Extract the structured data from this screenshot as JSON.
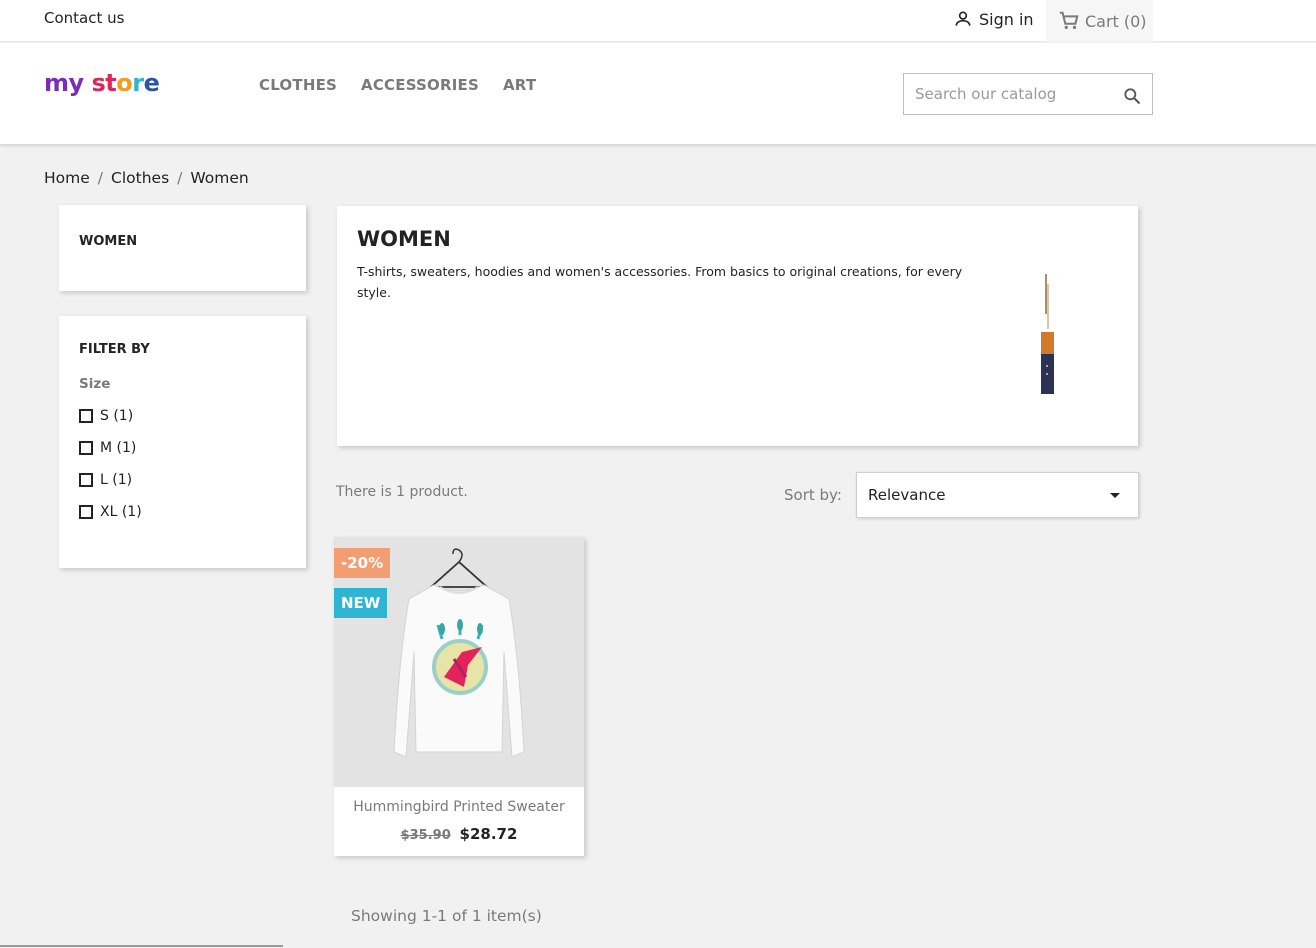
{
  "topbar": {
    "contact_label": "Contact us",
    "signin_label": "Sign in",
    "cart_label": "Cart",
    "cart_count": "(0)"
  },
  "header": {
    "logo_text": [
      "my",
      " ",
      "st",
      "o",
      "r",
      "e"
    ],
    "nav": [
      "CLOTHES",
      "ACCESSORIES",
      "ART"
    ],
    "search_placeholder": "Search our catalog"
  },
  "breadcrumb": [
    "Home",
    "Clothes",
    "Women"
  ],
  "sidebar": {
    "category_title": "WOMEN",
    "filter_title": "FILTER BY",
    "facet_label": "Size",
    "options": [
      {
        "label": "S (1)",
        "checked": false
      },
      {
        "label": "M (1)",
        "checked": false
      },
      {
        "label": "L (1)",
        "checked": false
      },
      {
        "label": "XL (1)",
        "checked": false
      }
    ]
  },
  "category": {
    "title": "WOMEN",
    "description": "T-shirts, sweaters, hoodies and women's accessories. From basics to original creations, for every style."
  },
  "listing": {
    "count_text": "There is 1 product.",
    "sort_label": "Sort by:",
    "sort_value": "Relevance",
    "showing_text": "Showing 1-1 of 1 item(s)"
  },
  "product": {
    "discount_flag": "-20%",
    "new_flag": "NEW",
    "name": "Hummingbird Printed Sweater",
    "old_price": "$35.90",
    "price": "$28.72"
  },
  "colors": {
    "accent": "#2fb5d2",
    "discount": "#f39d72",
    "background": "#f1f1f1"
  }
}
